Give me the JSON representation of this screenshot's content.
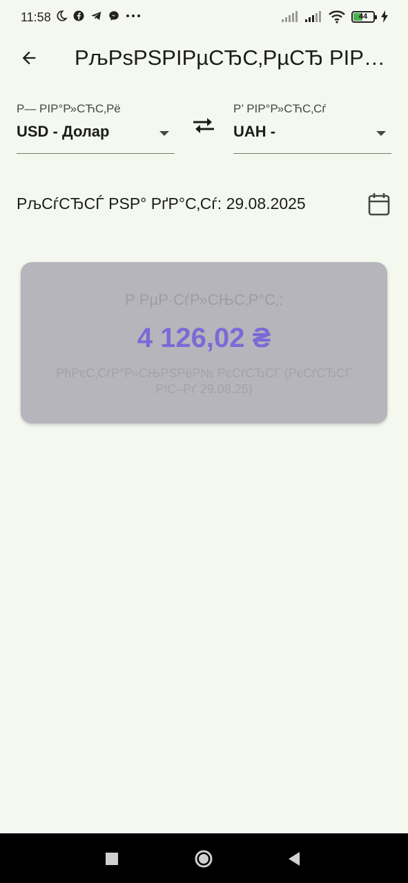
{
  "status_bar": {
    "time": "11:58",
    "battery_level": "44",
    "left_icons": [
      "moon-icon",
      "facebook-icon",
      "telegram-icon",
      "messenger-icon",
      "more-dots-icon"
    ],
    "right_icons": [
      "signal-icon",
      "signal-icon",
      "wifi-icon",
      "battery-icon",
      "charging-icon"
    ]
  },
  "app_bar": {
    "title": "РљРѕРЅРІРµСЂС‚РµСЂ РІР°Р»СЋС‚"
  },
  "converter": {
    "from_label": "Р— РІР°Р»СЋС‚Рё",
    "from_value": "USD - Долар",
    "to_label": "Р’ РІР°Р»СЋС‚Сѓ",
    "to_value": "UAH -",
    "rate_date_text": "РљСѓСЂСЃ РЅР° РґР°С‚Сѓ: 29.08.2025"
  },
  "result": {
    "label": "Р РµР·СѓР»СЊС‚Р°С‚:",
    "value": "4 126,02 ₴",
    "note": "РћРєС‚СѓР°Р»СЊРЅРёР№ РєСѓСЂСЃ (РєСѓСЂСЃ РІС–Рґ 29.08.25)"
  },
  "colors": {
    "background": "#f5f8ef",
    "card": "#b6b5bc",
    "result_value": "#7d69d6",
    "battery_fill": "#4caf50"
  }
}
